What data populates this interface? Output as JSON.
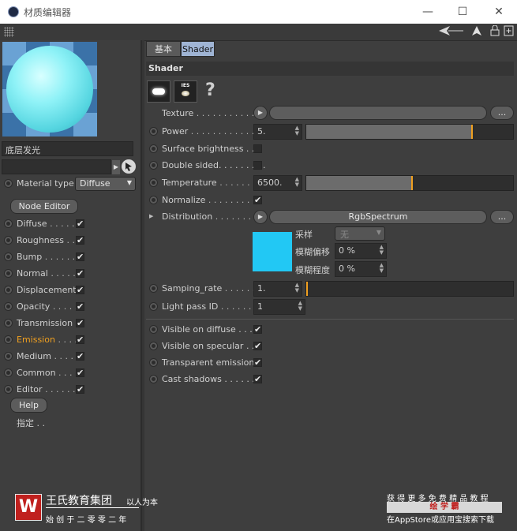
{
  "window": {
    "title": "材质编辑器",
    "minimize": "—",
    "maximize": "☐",
    "close": "✕"
  },
  "left": {
    "material_name": "底层发光",
    "material_type_label": "Material type",
    "material_type_value": "Diffuse",
    "node_editor": "Node Editor",
    "channels": [
      {
        "label": "Diffuse",
        "dots": ". . . . .",
        "checked": "✔"
      },
      {
        "label": "Roughness",
        "dots": ". .",
        "checked": "✔"
      },
      {
        "label": "Bump",
        "dots": ". . . . . .",
        "checked": "✔"
      },
      {
        "label": "Normal",
        "dots": ". . . . .",
        "checked": "✔"
      },
      {
        "label": "Displacement",
        "dots": "",
        "checked": "✔"
      },
      {
        "label": "Opacity",
        "dots": ". . . . .",
        "checked": "✔"
      },
      {
        "label": "Transmission",
        "dots": "",
        "checked": "✔"
      },
      {
        "label": "Emission",
        "dots": ". . . .",
        "checked": "✔"
      },
      {
        "label": "Medium",
        "dots": ". . . . .",
        "checked": "✔"
      },
      {
        "label": "Common",
        "dots": ". . . .",
        "checked": "✔"
      },
      {
        "label": "Editor",
        "dots": ". . . . . . .",
        "checked": "✔"
      }
    ],
    "help": "Help",
    "assign": "指定 . ."
  },
  "tabs": [
    {
      "label": "基本"
    },
    {
      "label": "Shader"
    }
  ],
  "section_title": "Shader",
  "shader": {
    "ies_label": "IES",
    "question": "?",
    "texture_label": "Texture",
    "texture_dots": ". . . . . . . . . . . .",
    "more": "...",
    "power_label": "Power",
    "power_dots": ". . . . . . . . . . . . .",
    "power_value": "5.",
    "power_fill": 0.8,
    "surface_brightness_label": "Surface brightness . .",
    "double_sided_label": "Double sided. . . . . . . . .",
    "temperature_label": "Temperature",
    "temperature_dots": ". . . . . . .",
    "temperature_value": "6500.",
    "temperature_fill": 0.51,
    "normalize_label": "Normalize",
    "normalize_dots": ". . . . . . . .",
    "normalize_check": "✔",
    "distribution_label": "Distribution",
    "distribution_dots": ". . . . . . . .",
    "distribution_value": "RgbSpectrum",
    "swatch_color": "#22c8f4",
    "sampling_label": "采样",
    "sampling_value": "无",
    "blur_offset_label": "模糊偏移",
    "blur_offset_value": "0 %",
    "blur_amount_label": "模糊程度",
    "blur_amount_value": "0 %",
    "samping_rate_label": "Samping_rate",
    "samping_rate_dots": ". . . . . . .",
    "samping_rate_value": "1.",
    "samping_rate_fill": 0,
    "light_pass_label": "Light pass ID",
    "light_pass_dots": ". . . . . . .",
    "light_pass_value": "1",
    "visible_diffuse_label": "Visible on diffuse . . .",
    "visible_specular_label": "Visible on specular . .",
    "transparent_emission_label": "Transparent emission",
    "cast_shadows_label": "Cast shadows . . . . . . .",
    "check": "✔"
  },
  "footer": {
    "logo_letter": "W",
    "brand": "王氏教育集团",
    "slogan": "以人为本",
    "since": "始 创 于 二 零 零 二 年",
    "right_line1": "获 得 更 多 免 费 精 品 教 程",
    "right_badge": "绘 学 霸",
    "right_line3": "在AppStore或应用宝搜索下载",
    "accent": "#c0201e"
  }
}
